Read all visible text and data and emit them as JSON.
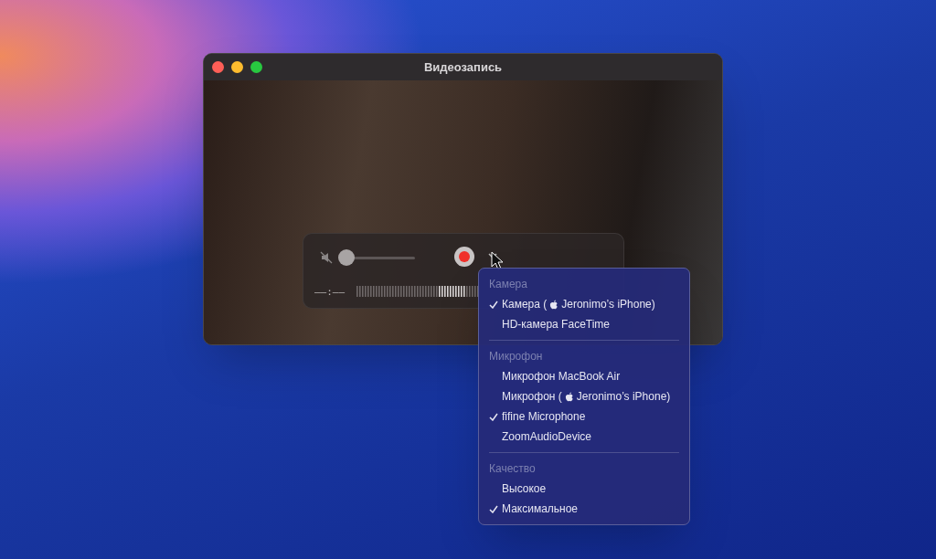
{
  "window": {
    "title": "Видеозапись"
  },
  "controls": {
    "muted": true,
    "volume": {
      "level": 0
    },
    "time": "––:––"
  },
  "menu": {
    "sections": [
      {
        "heading": "Камера",
        "items": [
          {
            "label": "Камера (",
            "logo": true,
            "label_after": "Jeronimo’s iPhone)",
            "checked": true
          },
          {
            "label": "HD-камера FaceTime",
            "logo": false,
            "checked": false
          }
        ]
      },
      {
        "heading": "Микрофон",
        "items": [
          {
            "label": "Микрофон MacBook Air",
            "logo": false,
            "checked": false
          },
          {
            "label": "Микрофон (",
            "logo": true,
            "label_after": "Jeronimo’s iPhone)",
            "checked": false
          },
          {
            "label": "fifine Microphone",
            "logo": false,
            "checked": true
          },
          {
            "label": "ZoomAudioDevice",
            "logo": false,
            "checked": false
          }
        ]
      },
      {
        "heading": "Качество",
        "items": [
          {
            "label": "Высокое",
            "logo": false,
            "checked": false
          },
          {
            "label": "Максимальное",
            "logo": false,
            "checked": true
          }
        ]
      }
    ]
  }
}
